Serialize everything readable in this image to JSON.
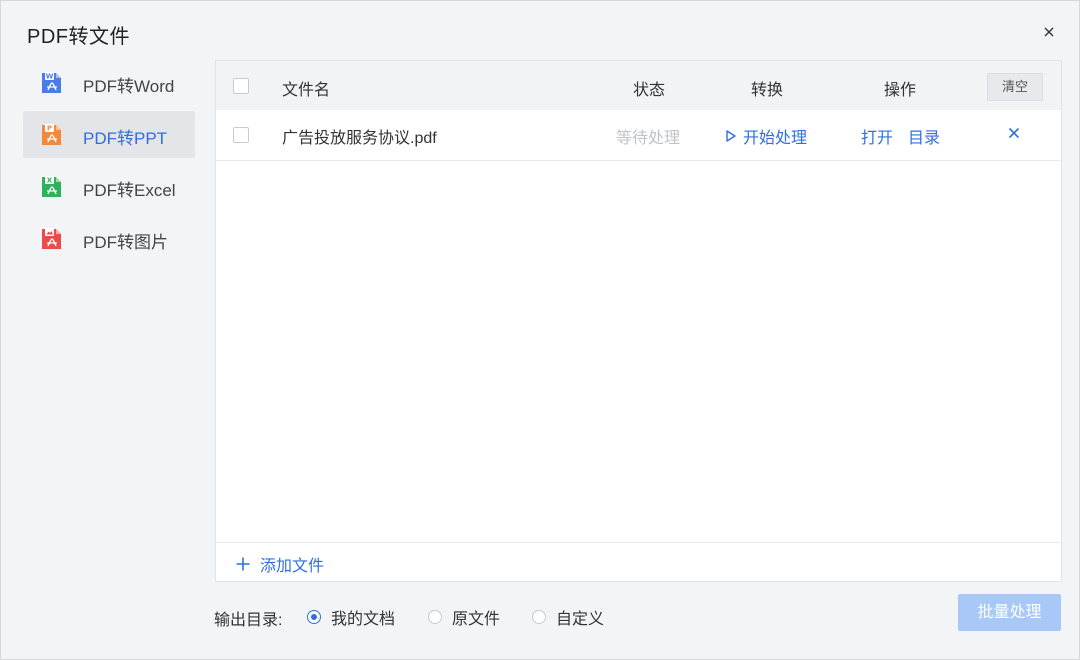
{
  "window": {
    "title": "PDF转文件"
  },
  "sidebar": {
    "items": [
      {
        "label": "PDF转Word",
        "icon": "word-file-icon",
        "color": "#4a7be6",
        "badge": "W",
        "active": false
      },
      {
        "label": "PDF转PPT",
        "icon": "ppt-file-icon",
        "color": "#f08a3c",
        "badge": "P",
        "active": true
      },
      {
        "label": "PDF转Excel",
        "icon": "excel-file-icon",
        "color": "#2fb35a",
        "badge": "X",
        "active": false
      },
      {
        "label": "PDF转图片",
        "icon": "image-file-icon",
        "color": "#ea4b4b",
        "badge": "",
        "active": false
      }
    ]
  },
  "table": {
    "headers": {
      "filename": "文件名",
      "status": "状态",
      "convert": "转换",
      "action": "操作"
    },
    "clear_label": "清空",
    "rows": [
      {
        "filename": "广告投放服务协议.pdf",
        "status": "等待处理",
        "convert": "开始处理",
        "open": "打开",
        "directory": "目录"
      }
    ],
    "add_file_label": "添加文件"
  },
  "output": {
    "label": "输出目录:",
    "options": [
      "我的文档",
      "原文件",
      "自定义"
    ],
    "selected": "我的文档"
  },
  "batch_button": "批量处理",
  "colors": {
    "accent": "#2f6fe0",
    "disabled_button": "#a8c8f8"
  }
}
